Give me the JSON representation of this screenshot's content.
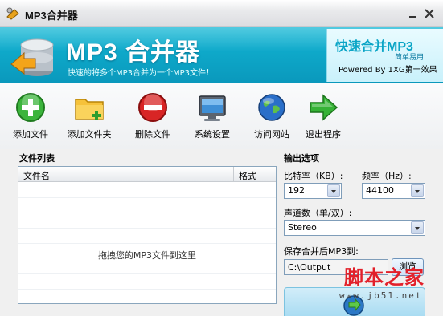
{
  "window": {
    "title": "MP3合并器",
    "minimize_icon": "minimize-icon",
    "close_icon": "close-icon"
  },
  "banner": {
    "app_name": "MP3 合并器",
    "description": "快速的将多个MP3合并为一个MP3文件！",
    "slogan": "快速合并MP3",
    "slogan_sub": "简单易用",
    "powered_by": "Powered By 1XG第一效果"
  },
  "toolbar": {
    "items": [
      {
        "label": "添加文件",
        "icon": "add-icon"
      },
      {
        "label": "添加文件夹",
        "icon": "folder-add-icon"
      },
      {
        "label": "删除文件",
        "icon": "delete-icon"
      },
      {
        "label": "系统设置",
        "icon": "monitor-icon"
      },
      {
        "label": "访问网站",
        "icon": "globe-icon"
      },
      {
        "label": "退出程序",
        "icon": "arrow-right-icon"
      }
    ]
  },
  "file_list": {
    "title": "文件列表",
    "columns": [
      "文件名",
      "格式"
    ],
    "drop_hint": "拖拽您的MP3文件到这里",
    "rows": []
  },
  "output": {
    "title": "输出选项",
    "bitrate_label": "比特率（KB）:",
    "bitrate_value": "192",
    "frequency_label": "频率（Hz）:",
    "frequency_value": "44100",
    "channels_label": "声道数（单/双）:",
    "channels_value": "Stereo",
    "save_label": "保存合并后MP3到:",
    "save_path": "C:\\Output",
    "browse_label": "浏览",
    "merge_icon": "merge-icon"
  },
  "watermark": {
    "main": "脚本之家",
    "sub": "www.jb51.net"
  },
  "colors": {
    "banner": "#0ea8c9",
    "slogan": "#0aa5c6",
    "watermark": "#e2202a"
  }
}
